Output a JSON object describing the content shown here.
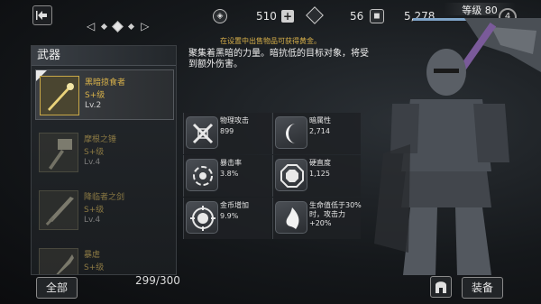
{
  "top_bar": {
    "gem_count": "510",
    "crystal_count": "56",
    "gold_count": "5,278",
    "level_label": "等级 80",
    "badge_value": "4",
    "xp_fraction": 0.72
  },
  "weapons_panel": {
    "title": "武器",
    "items": [
      {
        "name": "黑暗掠食者",
        "grade": "S+级",
        "level": "Lv.2"
      },
      {
        "name": "摩根之锤",
        "grade": "S+级",
        "level": "Lv.4"
      },
      {
        "name": "降临者之剑",
        "grade": "S+级",
        "level": "Lv.4"
      },
      {
        "name": "暴虐",
        "grade": "S+级",
        "level": ""
      }
    ]
  },
  "footer": {
    "all_label": "全部",
    "count": "299/300",
    "equip_label": "装备"
  },
  "description": {
    "hint": "在设置中出售物品可获得黄金。",
    "text": "聚集着黑暗的力量。暗抗低的目标对象，将受到额外伤害。"
  },
  "stats": [
    {
      "label": "物理攻击",
      "value": "899"
    },
    {
      "label": "暗属性",
      "value": "2,714"
    },
    {
      "label": "暴击率",
      "value": "3.8%"
    },
    {
      "label": "硬直度",
      "value": "1,125"
    },
    {
      "label": "金币增加",
      "value": "9.9%"
    },
    {
      "label": "生命值低于30%时，攻击力+20%",
      "value": ""
    }
  ],
  "icons": {
    "back": "back-icon",
    "gem": "gem-icon",
    "crystal": "crystal-icon",
    "gold": "gold-icon",
    "helmet": "helmet-icon"
  }
}
